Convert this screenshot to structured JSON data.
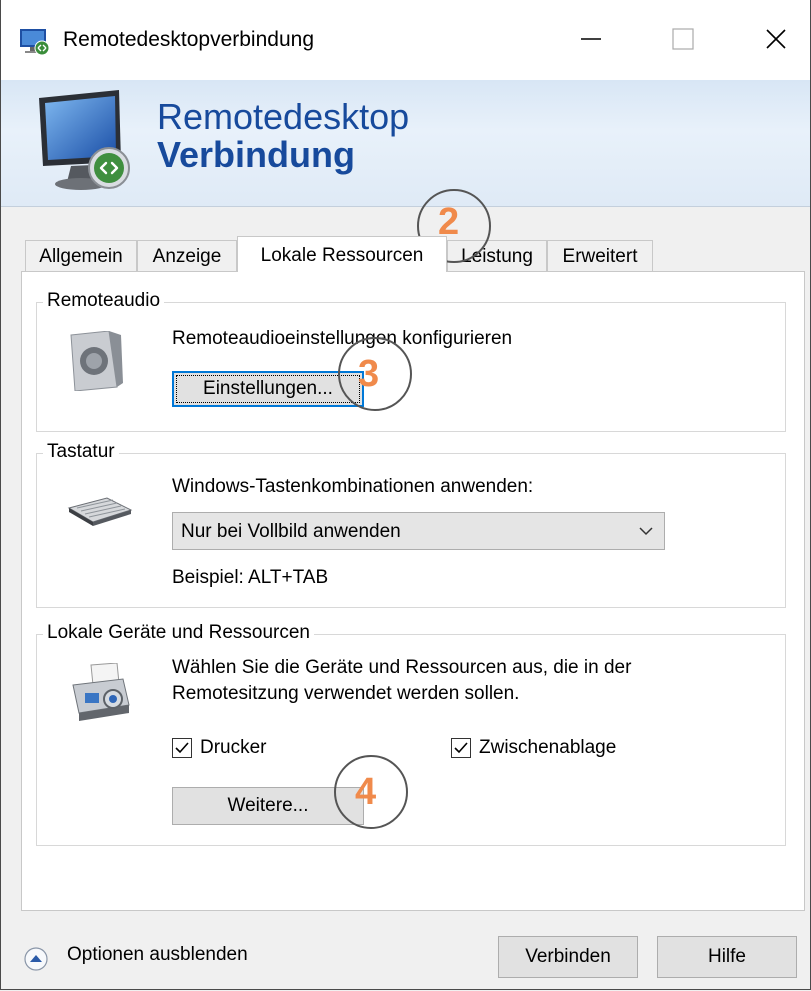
{
  "window": {
    "title": "Remotedesktopverbindung",
    "controls": {
      "minimize": "—",
      "maximize": "□",
      "close": "✕"
    }
  },
  "banner": {
    "line1": "Remotedesktop",
    "line2": "Verbindung"
  },
  "tabs": [
    {
      "label": "Allgemein",
      "active": false
    },
    {
      "label": "Anzeige",
      "active": false
    },
    {
      "label": "Lokale Ressourcen",
      "active": true
    },
    {
      "label": "Leistung",
      "active": false
    },
    {
      "label": "Erweitert",
      "active": false
    }
  ],
  "remoteaudio": {
    "legend": "Remoteaudio",
    "description": "Remoteaudioeinstellungen konfigurieren",
    "settings_button": "Einstellungen..."
  },
  "tastatur": {
    "legend": "Tastatur",
    "description": "Windows-Tastenkombinationen anwenden:",
    "selected": "Nur bei Vollbild anwenden",
    "example": "Beispiel: ALT+TAB"
  },
  "geraete": {
    "legend": "Lokale Geräte und Ressourcen",
    "description_line1": "Wählen Sie die Geräte und Ressourcen aus, die in der",
    "description_line2": "Remotesitzung verwendet werden sollen.",
    "drucker": {
      "label": "Drucker",
      "checked": true
    },
    "zwischenablage": {
      "label": "Zwischenablage",
      "checked": true
    },
    "more_button": "Weitere..."
  },
  "annotations": [
    "2",
    "3",
    "4"
  ],
  "footer": {
    "options_link": "Optionen ausblenden",
    "connect_button": "Verbinden",
    "help_button": "Hilfe"
  },
  "colors": {
    "accent": "#0078d7",
    "banner_text": "#174a9c",
    "annotation": "#f08a4b"
  }
}
